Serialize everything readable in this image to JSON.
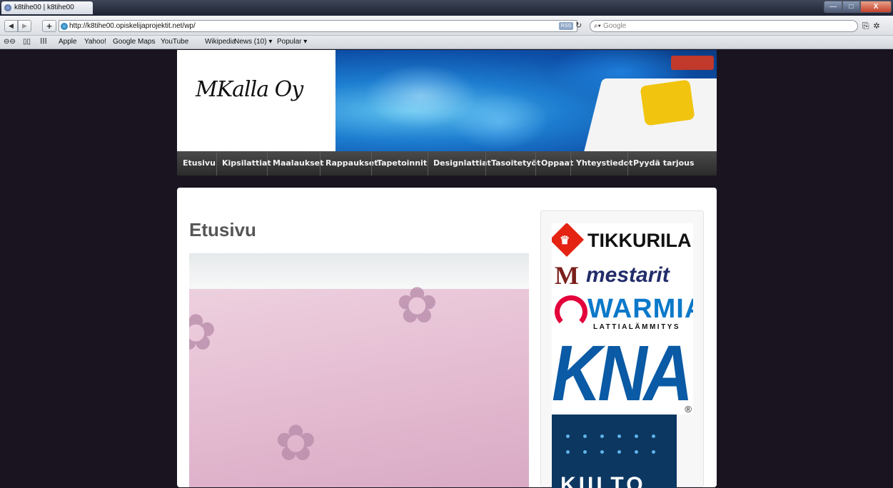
{
  "browser": {
    "tab_title": "k8tihe00 | k8tihe00",
    "back_label": "◀",
    "forward_label": "▶",
    "add_label": "+",
    "url": "http://k8tihe00.opiskelijaprojektit.net/wp/",
    "rss_label": "RSS",
    "search_placeholder": "Google",
    "window_minimize": "—",
    "window_maximize": "□",
    "window_close": "X"
  },
  "bookmarks": [
    {
      "label": "Apple"
    },
    {
      "label": "Yahoo!"
    },
    {
      "label": "Google Maps"
    },
    {
      "label": "YouTube"
    },
    {
      "label": "Wikipedia"
    },
    {
      "label": "News (10) ▾"
    },
    {
      "label": "Popular ▾"
    }
  ],
  "site": {
    "logo_text": "MKalla Oy",
    "nav": [
      {
        "label": "Etusivu"
      },
      {
        "label": "Kipsilattiat"
      },
      {
        "label": "Maalaukset"
      },
      {
        "label": "Rappaukset"
      },
      {
        "label": "Tapetoinnit"
      },
      {
        "label": "Designlattiat"
      },
      {
        "label": "Tasoitetyöt"
      },
      {
        "label": "Oppaat"
      },
      {
        "label": "Yhteystiedot"
      },
      {
        "label": "Pyydä tarjous"
      }
    ],
    "page_title": "Etusivu",
    "sidebar_brands": {
      "tikkurila": "TIKKURILA",
      "mestarit_m": "M",
      "mestarit": "mestarit",
      "warmia": "WARMIA",
      "warmia_sub": "LATTIALÄMMITYS",
      "knauf": "KNAUF",
      "knauf_reg": "®",
      "kiilto": "KIILTO"
    }
  },
  "colors": {
    "page_bg": "#1a1420",
    "nav_bg": "#3a3a3a",
    "title_color": "#555555",
    "tikkurila_red": "#e42313",
    "warmia_blue": "#0b79c9",
    "knauf_blue": "#0a5aa5",
    "kiilto_navy": "#0c3761"
  }
}
